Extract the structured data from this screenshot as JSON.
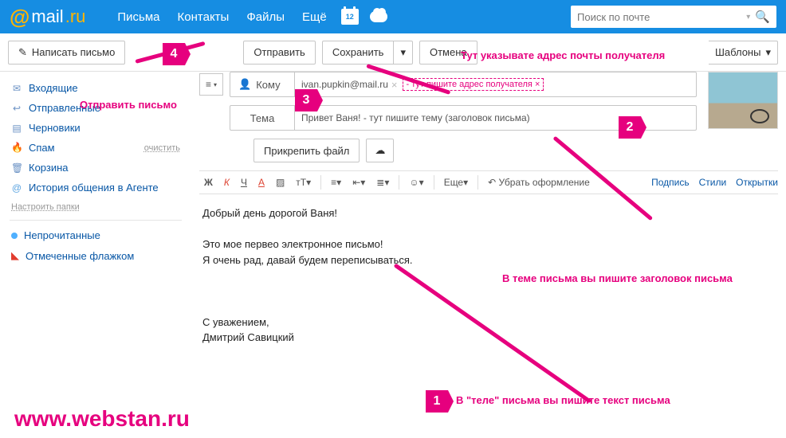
{
  "header": {
    "logo_at": "@",
    "logo_mail": "mail",
    "logo_ru": ".ru",
    "nav": {
      "mail": "Письма",
      "contacts": "Контакты",
      "files": "Файлы",
      "more": "Ещё"
    },
    "cal_day": "12",
    "search_placeholder": "Поиск по почте"
  },
  "actions": {
    "compose": "Написать письмо",
    "send": "Отправить",
    "save": "Сохранить",
    "cancel": "Отмена",
    "templates": "Шаблоны"
  },
  "sidebar": {
    "inbox": "Входящие",
    "sent": "Отправленные",
    "drafts": "Черновики",
    "spam": "Спам",
    "clear": "очистить",
    "trash": "Корзина",
    "agent": "История общения в Агенте",
    "configure": "Настроить папки",
    "unread": "Непрочитанные",
    "flagged": "Отмеченные флажком"
  },
  "compose": {
    "to_label": "Кому",
    "to_value": "ivan.pupkin@mail.ru",
    "to_hint": "- тут пишите адрес получателя",
    "subject_label": "Тема",
    "subject_value": "Привет Ваня!  - тут пишите тему (заголовок письма)",
    "attach": "Прикрепить файл",
    "body": "Добрый день дорогой Ваня!\n\nЭто мое первео электронное письмо!\nЯ очень рад, давай будем переписываться.\n\n\n\nС уважением,\nДмитрий Савицкий"
  },
  "fmt": {
    "bold": "Ж",
    "italic": "К",
    "underline": "Ч",
    "font": "A",
    "bg": "▨",
    "size": "тТ",
    "align": "≡",
    "indent": "⇤",
    "list": "≣",
    "emoji": "☺",
    "more": "Еще",
    "remove_fmt": "Убрать оформление",
    "signature": "Подпись",
    "styles": "Стили",
    "cards": "Открытки"
  },
  "annotations": {
    "m1": "1",
    "m2": "2",
    "m3": "3",
    "m4": "4",
    "send_letter": "Отправить письмо",
    "recipient": "Тут указывате адрес почты получателя",
    "subject_hint": "В теме письма вы пишите заголовок письма",
    "body_hint": "В \"теле\" письма вы пишите текст письма",
    "watermark": "www.webstan.ru"
  }
}
